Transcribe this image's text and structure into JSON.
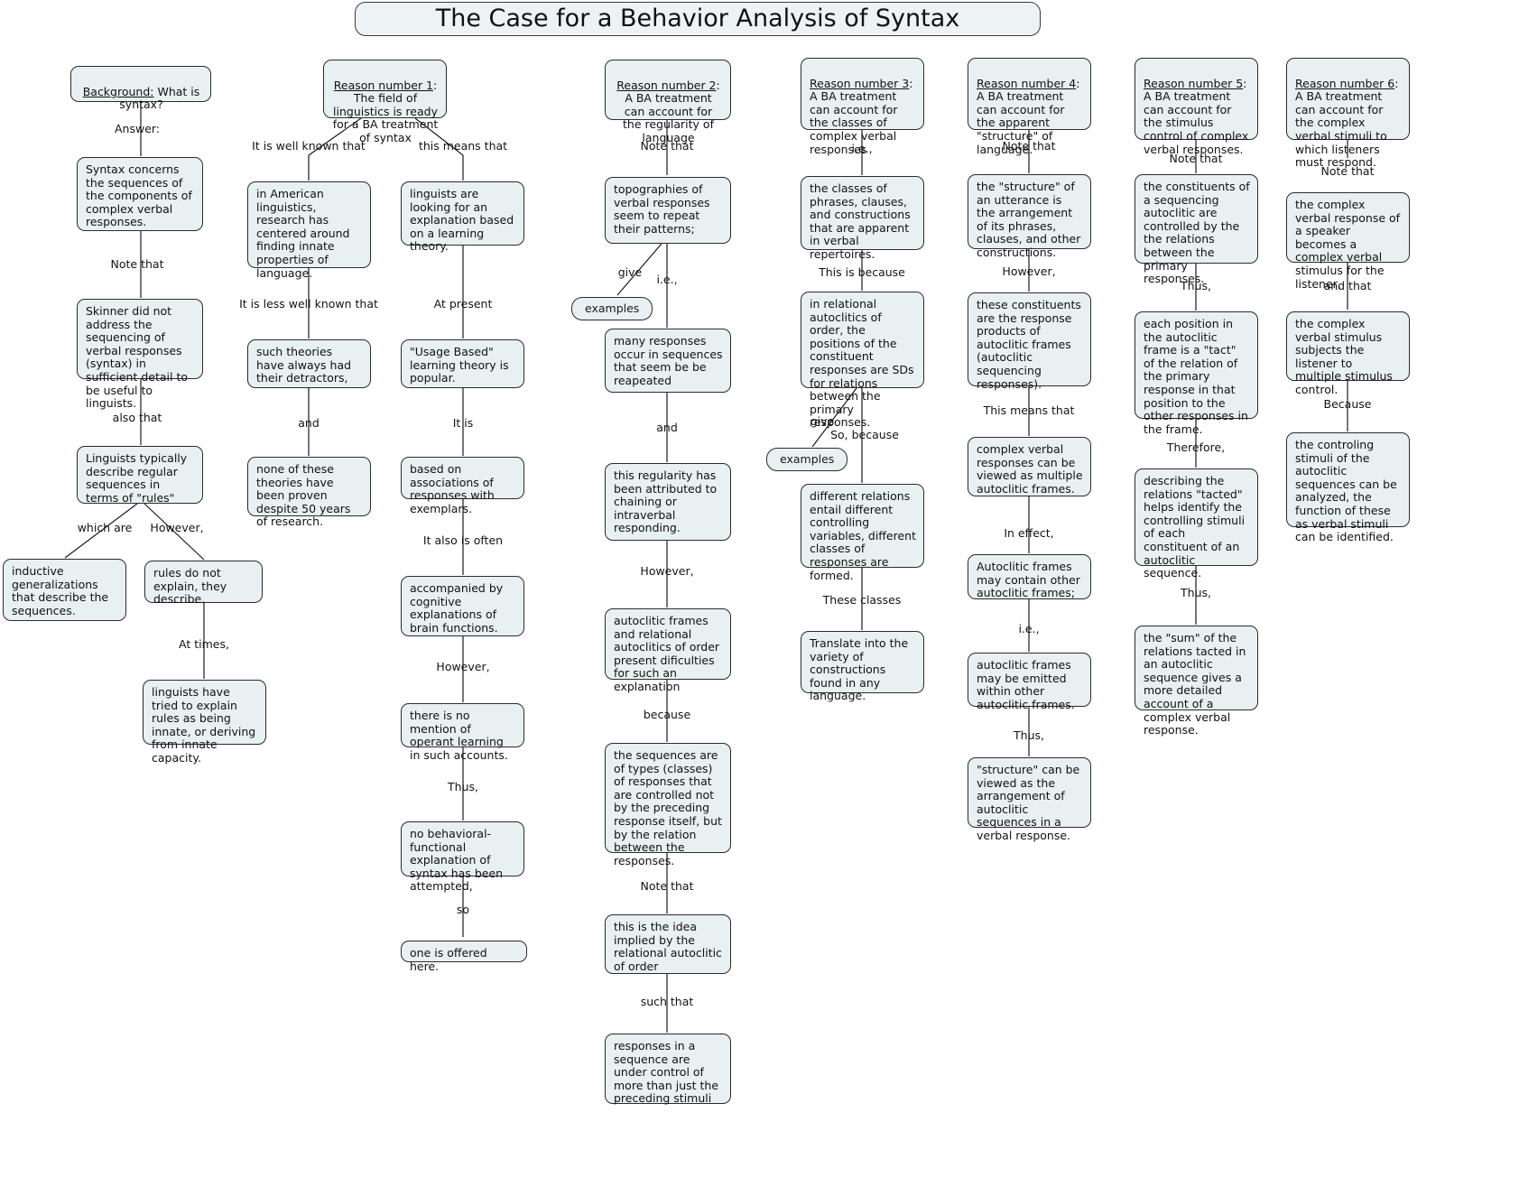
{
  "title": "The Case for a Behavior Analysis of Syntax",
  "columns": [
    {
      "name": "background",
      "nodes": [
        {
          "id": "bg-root",
          "header": "Background:",
          "text": " What is syntax?"
        },
        {
          "id": "bg-1",
          "text": "Syntax concerns the sequences of the components of complex verbal responses."
        },
        {
          "id": "bg-2",
          "text": "Skinner did not address the sequencing of verbal responses (syntax) in sufficient detail to be useful to linguists."
        },
        {
          "id": "bg-3",
          "text": "Linguists typically describe regular sequences in terms of \"rules\""
        },
        {
          "id": "bg-4",
          "text": "inductive generalizations that describe the sequences."
        },
        {
          "id": "bg-5",
          "text": "rules do not explain, they describe."
        },
        {
          "id": "bg-6",
          "text": "linguists have tried to explain rules as being innate, or deriving from innate capacity."
        }
      ],
      "labels": [
        "Answer:",
        "Note that",
        "also that",
        "which are",
        "However,",
        "At times,"
      ]
    },
    {
      "name": "reason-1",
      "nodes": [
        {
          "id": "r1-root",
          "header": "Reason number 1",
          "text": ": The field of linguistics is ready for a BA treatment of syntax"
        },
        {
          "id": "r1-a1",
          "text": "in American linguistics, research has centered around finding innate properties of language."
        },
        {
          "id": "r1-a2",
          "text": "such theories have always had their detractors,"
        },
        {
          "id": "r1-a3",
          "text": "none of these theories have been proven despite 50 years of research."
        },
        {
          "id": "r1-b1",
          "text": "linguists are looking for an explanation based on a learning theory."
        },
        {
          "id": "r1-b2",
          "text": "\"Usage Based\" learning theory is popular."
        },
        {
          "id": "r1-b3",
          "text": "based on associations of responses with exemplars."
        },
        {
          "id": "r1-b4",
          "text": "accompanied by cognitive explanations of brain functions."
        },
        {
          "id": "r1-b5",
          "text": "there is no mention of operant learning in such accounts."
        },
        {
          "id": "r1-b6",
          "text": "no behavioral-functional explanation of syntax has been attempted,"
        },
        {
          "id": "r1-b7",
          "text": "one is offered here."
        }
      ],
      "labels": [
        "It is well known that",
        "this means that",
        "It is less well known that",
        "At present",
        "and",
        "It is",
        "It also is often",
        "However,",
        "Thus,",
        "so"
      ]
    },
    {
      "name": "reason-2",
      "nodes": [
        {
          "id": "r2-root",
          "header": "Reason number 2",
          "text": ": A BA treatment can account for the regularity of language"
        },
        {
          "id": "r2-1",
          "text": "topographies of verbal responses seem to repeat their patterns;"
        },
        {
          "id": "r2-ex",
          "text": "examples"
        },
        {
          "id": "r2-2",
          "text": "many responses occur in sequences that seem be be reapeated"
        },
        {
          "id": "r2-3",
          "text": "this regularity has been attributed to chaining or intraverbal responding."
        },
        {
          "id": "r2-4",
          "text": "autoclitic frames and relational autoclitics of order present dificulties for such an explanation"
        },
        {
          "id": "r2-5",
          "text": "the sequences are of types (classes) of responses that are controlled not by the preceding response itself, but by the relation between the responses."
        },
        {
          "id": "r2-6",
          "text": "this is the idea implied by the relational autoclitic of order"
        },
        {
          "id": "r2-7",
          "text": "responses in a sequence are under control of more than just the preceding stimuli"
        }
      ],
      "labels": [
        "Note that",
        "give",
        "i.e.,",
        "and",
        "However,",
        "because",
        "Note that",
        "such that"
      ]
    },
    {
      "name": "reason-3",
      "nodes": [
        {
          "id": "r3-root",
          "header": "Reason number 3",
          "text": ": A BA treatment can account for the classes of complex verbal responses"
        },
        {
          "id": "r3-1",
          "text": "the classes of phrases, clauses, and constructions that are apparent in verbal repertoires."
        },
        {
          "id": "r3-2",
          "text": "in relational autoclitics of order, the positions of the constituent responses are SDs for relations between the primary responses."
        },
        {
          "id": "r3-ex",
          "text": "examples"
        },
        {
          "id": "r3-3",
          "text": "different relations entail different controlling variables, different classes of responses are formed."
        },
        {
          "id": "r3-4",
          "text": "Translate into the variety of constructions found in any language."
        }
      ],
      "labels": [
        "i.e.,",
        "This is because",
        "give",
        "So, because",
        "These classes"
      ]
    },
    {
      "name": "reason-4",
      "nodes": [
        {
          "id": "r4-root",
          "header": "Reason number 4",
          "text": ": A BA treatment can account for the apparent \"structure\" of language."
        },
        {
          "id": "r4-1",
          "text": "the \"structure\" of an utterance is the arrangement of its phrases, clauses, and other constructions."
        },
        {
          "id": "r4-2",
          "text": "these constituents are the response products of autoclitic frames (autoclitic sequencing responses)."
        },
        {
          "id": "r4-3",
          "text": "complex verbal responses can be viewed as multiple autoclitic frames."
        },
        {
          "id": "r4-4",
          "text": "Autoclitic frames may contain other autoclitic frames;"
        },
        {
          "id": "r4-5",
          "text": "autoclitic frames may be emitted within other autoclitic frames."
        },
        {
          "id": "r4-6",
          "text": "\"structure\" can be viewed as the arrangement of autoclitic sequences in a verbal response."
        }
      ],
      "labels": [
        "Note that",
        "However,",
        "This means that",
        "In effect,",
        "i.e.,",
        "Thus,"
      ]
    },
    {
      "name": "reason-5",
      "nodes": [
        {
          "id": "r5-root",
          "header": "Reason number 5",
          "text": ": A BA treatment can account for the stimulus control of complex verbal responses."
        },
        {
          "id": "r5-1",
          "text": "the constituents of a sequencing autoclitic are controlled by the the relations between the primary responses."
        },
        {
          "id": "r5-2",
          "text": "each position in the autoclitic frame is a \"tact\" of the relation of the primary response in that position to the other responses in the frame."
        },
        {
          "id": "r5-3",
          "text": "describing the relations \"tacted\" helps identify the controlling stimuli of each constituent of an autoclitic sequence."
        },
        {
          "id": "r5-4",
          "text": "the \"sum\" of the relations tacted in an autoclitic sequence gives a more detailed account of a complex verbal response."
        }
      ],
      "labels": [
        "Note that",
        "Thus,",
        "Therefore,",
        "Thus,"
      ]
    },
    {
      "name": "reason-6",
      "nodes": [
        {
          "id": "r6-root",
          "header": "Reason number 6",
          "text": ": A BA treatment can account for the complex verbal stimuli to which listeners must respond."
        },
        {
          "id": "r6-1",
          "text": "the complex verbal response of a speaker becomes a complex verbal stimulus for the listener,"
        },
        {
          "id": "r6-2",
          "text": "the complex verbal stimulus subjects the listener to multiple stimulus control."
        },
        {
          "id": "r6-3",
          "text": "the controling stimuli of the autoclitic sequences can be analyzed, the function of these as verbal stimuli can be identified."
        }
      ],
      "labels": [
        "Note that",
        "and that",
        "Because"
      ]
    }
  ],
  "colors": {
    "node_fill": "#e8f0f2",
    "node_border": "#2b2b2b",
    "edge": "#1a1a1a",
    "text": "#111111",
    "background": "#ffffff"
  }
}
